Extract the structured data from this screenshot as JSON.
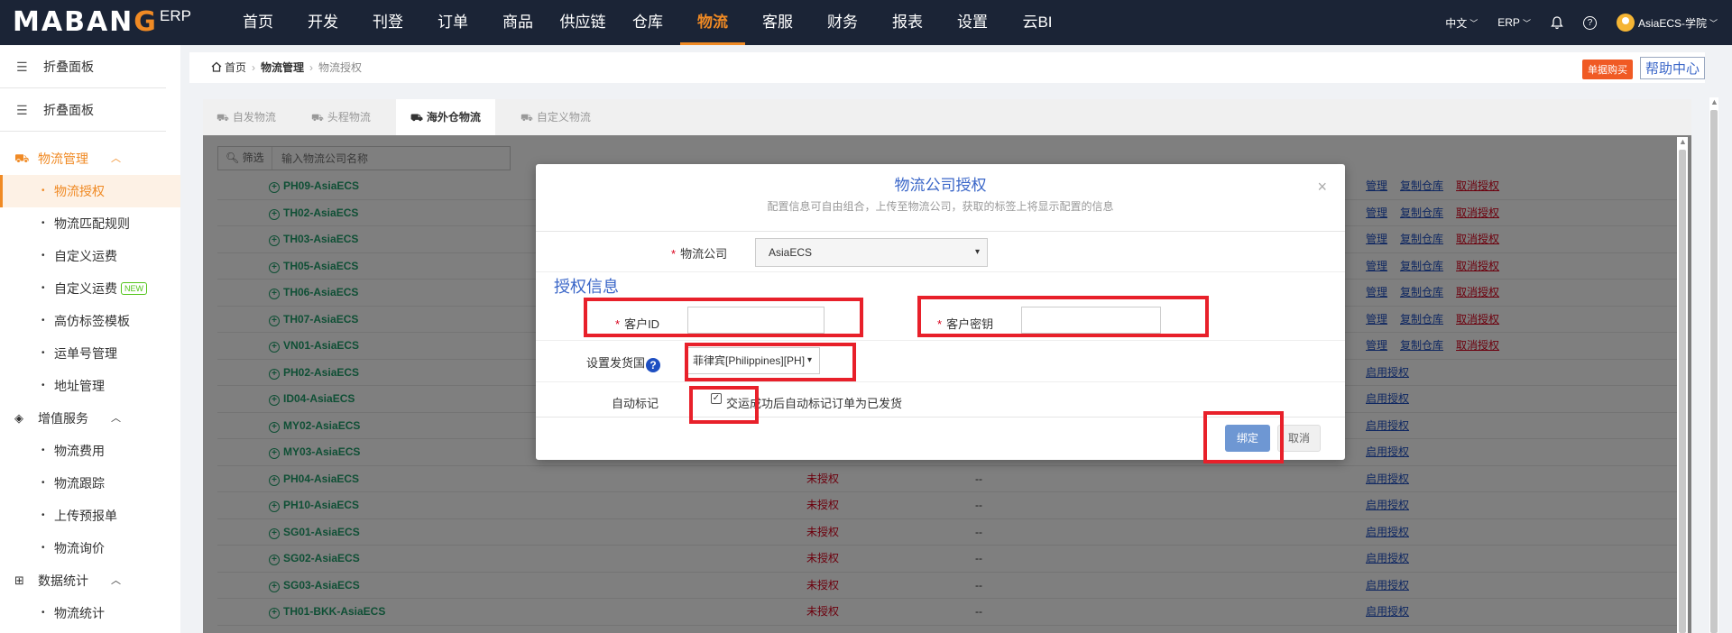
{
  "logo": {
    "brand_pre": "MABAN",
    "brand_g": "G",
    "erp": "ERP"
  },
  "topnav": {
    "items": [
      "首页",
      "开发",
      "刊登",
      "订单",
      "商品",
      "供应链",
      "仓库",
      "物流",
      "客服",
      "财务",
      "报表",
      "设置",
      "云BI"
    ],
    "active_index": 7,
    "lang": "中文",
    "erp": "ERP",
    "user": "AsiaECS-学院"
  },
  "sidebar": {
    "folds": [
      "折叠面板",
      "折叠面板"
    ],
    "groups": [
      {
        "label": "物流管理",
        "active": true,
        "items": [
          "物流授权",
          "物流匹配规则",
          "自定义运费",
          "自定义运费",
          "高仿标签模板",
          "运单号管理",
          "地址管理"
        ],
        "active_item": 0
      },
      {
        "label": "增值服务",
        "items": [
          "物流费用",
          "物流跟踪",
          "上传预报单",
          "物流询价"
        ]
      },
      {
        "label": "数据统计",
        "items": [
          "物流统计"
        ]
      }
    ],
    "new_badge": "NEW"
  },
  "breadcrumb": {
    "home": "首页",
    "mid": "物流管理",
    "current": "物流授权"
  },
  "buy_label": "单据购买",
  "help_label": "帮助中心",
  "tabs": [
    "自发物流",
    "头程物流",
    "海外仓物流",
    "自定义物流"
  ],
  "active_tab": 2,
  "filter": {
    "label": "筛选",
    "placeholder": "输入物流公司名称"
  },
  "rows": [
    {
      "name": "PH09-AsiaECS",
      "acts": [
        "管理",
        "复制仓库",
        "取消授权"
      ]
    },
    {
      "name": "TH02-AsiaECS",
      "acts": [
        "管理",
        "复制仓库",
        "取消授权"
      ]
    },
    {
      "name": "TH03-AsiaECS",
      "acts": [
        "管理",
        "复制仓库",
        "取消授权"
      ]
    },
    {
      "name": "TH05-AsiaECS",
      "acts": [
        "管理",
        "复制仓库",
        "取消授权"
      ]
    },
    {
      "name": "TH06-AsiaECS",
      "acts": [
        "管理",
        "复制仓库",
        "取消授权"
      ]
    },
    {
      "name": "TH07-AsiaECS",
      "acts": [
        "管理",
        "复制仓库",
        "取消授权"
      ]
    },
    {
      "name": "VN01-AsiaECS",
      "acts": [
        "管理",
        "复制仓库",
        "取消授权"
      ]
    },
    {
      "name": "PH02-AsiaECS",
      "acts": [
        "启用授权"
      ]
    },
    {
      "name": "ID04-AsiaECS",
      "acts": [
        "启用授权"
      ]
    },
    {
      "name": "MY02-AsiaECS",
      "acts": [
        "启用授权"
      ]
    },
    {
      "name": "MY03-AsiaECS",
      "acts": [
        "启用授权"
      ]
    },
    {
      "name": "PH04-AsiaECS",
      "status": "未授权",
      "dash": "--",
      "acts": [
        "启用授权"
      ]
    },
    {
      "name": "PH10-AsiaECS",
      "status": "未授权",
      "dash": "--",
      "acts": [
        "启用授权"
      ]
    },
    {
      "name": "SG01-AsiaECS",
      "status": "未授权",
      "dash": "--",
      "acts": [
        "启用授权"
      ]
    },
    {
      "name": "SG02-AsiaECS",
      "status": "未授权",
      "dash": "--",
      "acts": [
        "启用授权"
      ]
    },
    {
      "name": "SG03-AsiaECS",
      "status": "未授权",
      "dash": "--",
      "acts": [
        "启用授权"
      ]
    },
    {
      "name": "TH01-BKK-AsiaECS",
      "status": "未授权",
      "dash": "--",
      "acts": [
        "启用授权"
      ]
    }
  ],
  "modal": {
    "title": "物流公司授权",
    "subtitle": "配置信息可自由组合，上传至物流公司，获取的标签上将显示配置的信息",
    "company_label": "物流公司",
    "company_value": "AsiaECS",
    "auth_header": "授权信息",
    "customer_id_label": "客户ID",
    "customer_key_label": "客户密钥",
    "ship_country_label": "设置发货国",
    "ship_country_value": "菲律宾[Philippines][PH]",
    "auto_mark_label": "自动标记",
    "auto_mark_text": "交运成功后自动标记订单为已发货",
    "bind_label": "绑定",
    "cancel_label": "取消"
  }
}
